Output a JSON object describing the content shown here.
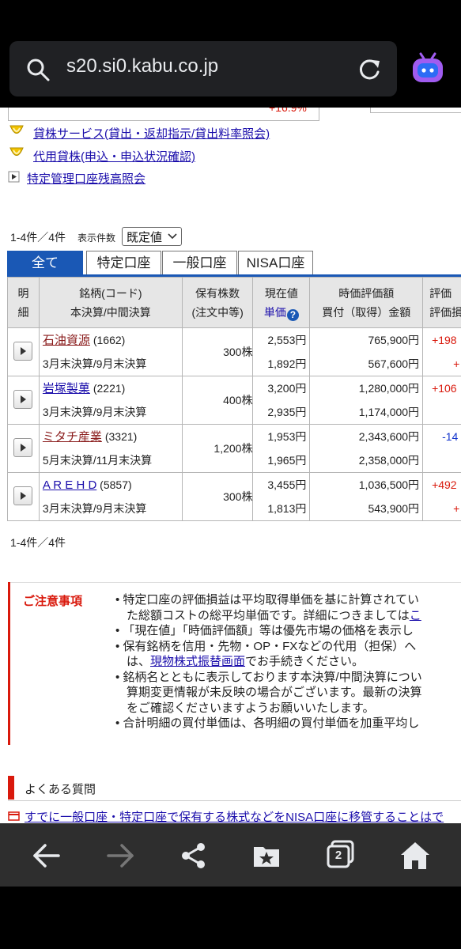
{
  "browser": {
    "url": "s20.si0.kabu.co.jp",
    "tab_count": "2"
  },
  "top_partial": {
    "percent_fragment": "+16.9%"
  },
  "service_links": [
    {
      "label": "貸株サービス(貸出・返却指示/貸出料率照会)"
    },
    {
      "label": "代用貸株(申込・申込状況確認)"
    },
    {
      "label": "特定管理口座残高照会"
    }
  ],
  "list_controls": {
    "range_top": "1-4件／4件",
    "display_count_label": "表示件数",
    "display_count_value": "既定値",
    "range_bottom": "1-4件／4件"
  },
  "tabs": [
    {
      "label": "全て"
    },
    {
      "label": "特定口座"
    },
    {
      "label": "一般口座"
    },
    {
      "label": "NISA口座"
    }
  ],
  "table": {
    "headers": {
      "detail_1": "明",
      "detail_2": "細",
      "name_1": "銘柄(コード)",
      "name_2": "本決算/中間決算",
      "qty_1": "保有株数",
      "qty_2": "(注文中等)",
      "price_1": "現在値",
      "price_2": "単価",
      "value_1": "時価評価額",
      "value_2": "買付（取得）金額",
      "eval_1": "評価",
      "eval_2": "評価損"
    },
    "rows": [
      {
        "name": "石油資源",
        "code": "(1662)",
        "fiscal": "3月末決算/9月末決算",
        "qty": "300株",
        "price": "2,553円",
        "unit_price": "1,892円",
        "market_value": "765,900円",
        "cost": "567,600円",
        "pl": "+198",
        "pl2": "+"
      },
      {
        "name": "岩塚製菓",
        "code": "(2221)",
        "fiscal": "3月末決算/9月末決算",
        "qty": "400株",
        "price": "3,200円",
        "unit_price": "2,935円",
        "market_value": "1,280,000円",
        "cost": "1,174,000円",
        "pl": "+106",
        "pl2": ""
      },
      {
        "name": "ミタチ産業",
        "code": "(3321)",
        "fiscal": "5月末決算/11月末決算",
        "qty": "1,200株",
        "price": "1,953円",
        "unit_price": "1,965円",
        "market_value": "2,343,600円",
        "cost": "2,358,000円",
        "pl": "-14",
        "pl2": ""
      },
      {
        "name": "A R E H D",
        "code": "(5857)",
        "fiscal": "3月末決算/9月末決算",
        "qty": "300株",
        "price": "3,455円",
        "unit_price": "1,813円",
        "market_value": "1,036,500円",
        "cost": "543,900円",
        "pl": "+492",
        "pl2": "+"
      }
    ]
  },
  "notice": {
    "title": "ご注意事項",
    "lines": [
      "• 特定口座の評価損益は平均取得単価を基に計算されてい",
      "た総額コストの総平均単価です。詳細につきましては",
      "• 「現在値」「時価評価額」等は優先市場の価格を表示し",
      "• 保有銘柄を信用・先物・OP・FXなどの代用（担保）へ",
      "は、",
      "でお手続きください。",
      "• 銘柄名とともに表示しております本決算/中間決算につい",
      "算期変更情報が未反映の場合がございます。最新の決算",
      "をご確認くださいますようお願いいたします。",
      "• 合計明細の買付単価は、各明細の買付単価を加重平均し"
    ],
    "link_here": "こ",
    "link_transfer": "現物株式振替画面"
  },
  "faq": {
    "title": "よくある質問",
    "item": "すでに一般口座・特定口座で保有する株式などをNISA口座に移管することはで"
  },
  "colors": {
    "accent_blue": "#1a58b5",
    "plus_red": "#d9190c",
    "minus_blue": "#1133cc",
    "notice_red": "#d9190c",
    "browser_icon": "#a05cf0"
  }
}
